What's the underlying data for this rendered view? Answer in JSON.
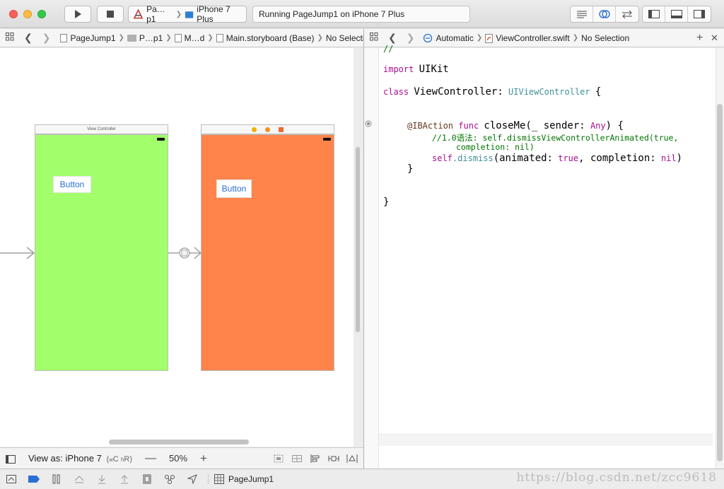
{
  "toolbar": {
    "scheme_project": "Pa…p1",
    "scheme_device": "iPhone 7 Plus",
    "activity_status": "Running PageJump1 on iPhone 7 Plus"
  },
  "left_jumpbar": {
    "items": [
      "PageJump1",
      "P…p1",
      "M…d",
      "Main.storyboard (Base)",
      "No Selection"
    ]
  },
  "right_jumpbar": {
    "items": [
      "Automatic",
      "ViewController.swift",
      "No Selection"
    ]
  },
  "canvas": {
    "scene1": {
      "title": "View Controller",
      "button_label": "Button",
      "background": "#a2ff6b"
    },
    "scene2": {
      "button_label": "Button",
      "background": "#ff844c"
    }
  },
  "canvas_bar": {
    "view_as": "View as: iPhone 7",
    "size_class_w": "w",
    "size_class_wv": "C",
    "size_class_h": "h",
    "size_class_hv": "R",
    "zoom": "50%"
  },
  "code": {
    "line_top": "//",
    "import_kw": "import",
    "import_name": "UIKit",
    "class_kw": "class",
    "class_name": "ViewController:",
    "superclass": "UIViewController",
    "brace_open": "{",
    "attr": "@IBAction",
    "func_kw": "func",
    "func_sig": "closeMe(_ sender:",
    "any_type": "Any",
    "func_brace": ") {",
    "comment1": "//1.0语法: self.dismissViewControllerAnimated(true,",
    "comment2": "completion: nil)",
    "self_kw": "self",
    "dismiss_call": ".dismiss",
    "dismiss_args_a": "(animated:",
    "true_kw": "true",
    "dismiss_args_b": ", completion:",
    "nil_kw": "nil",
    "dismiss_close": ")",
    "func_close": "}",
    "class_close": "}"
  },
  "debugbar": {
    "target": "PageJump1"
  },
  "watermark": "https://blog.csdn.net/zcc9618"
}
